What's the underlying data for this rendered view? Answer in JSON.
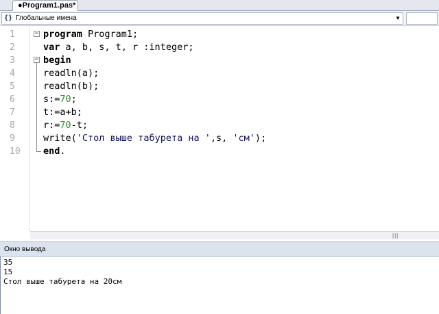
{
  "tabs": [
    {
      "label": "●Program1.pas*"
    }
  ],
  "scope_bar": {
    "icon": "braces-icon",
    "icon_text": "{}",
    "label": "Глобальные имена"
  },
  "editor": {
    "line_numbers": [
      "1",
      "2",
      "3",
      "4",
      "5",
      "6",
      "7",
      "8",
      "9",
      "10"
    ],
    "lines": [
      [
        {
          "t": "program",
          "c": "kw"
        },
        {
          "t": " Program1;",
          "c": "ident"
        }
      ],
      [
        {
          "t": "var",
          "c": "kw"
        },
        {
          "t": " a, b, s, t, r :integer;",
          "c": "ident"
        }
      ],
      [
        {
          "t": "begin",
          "c": "kw"
        }
      ],
      [
        {
          "t": "readln(a);",
          "c": "ident"
        }
      ],
      [
        {
          "t": "readln(b);",
          "c": "ident"
        }
      ],
      [
        {
          "t": "s:=",
          "c": "ident"
        },
        {
          "t": "70",
          "c": "num"
        },
        {
          "t": ";",
          "c": "ident"
        }
      ],
      [
        {
          "t": "t:=a+b;",
          "c": "ident"
        }
      ],
      [
        {
          "t": "r:=",
          "c": "ident"
        },
        {
          "t": "70",
          "c": "num"
        },
        {
          "t": "-t;",
          "c": "ident"
        }
      ],
      [
        {
          "t": "write(",
          "c": "ident"
        },
        {
          "t": "'Стол выше табурета на '",
          "c": "str"
        },
        {
          "t": ",s, ",
          "c": "ident"
        },
        {
          "t": "'см'",
          "c": "str"
        },
        {
          "t": ");",
          "c": "ident"
        }
      ],
      [
        {
          "t": "end",
          "c": "kw"
        },
        {
          "t": ".",
          "c": "ident"
        }
      ]
    ]
  },
  "output": {
    "title": "Окно вывода",
    "lines": [
      "35",
      "15",
      "Стол выше табурета на 20см"
    ]
  },
  "colors": {
    "keyword": "#000000",
    "number": "#2e8b2e",
    "string": "#14145c",
    "line_number": "#a8a8a8"
  }
}
